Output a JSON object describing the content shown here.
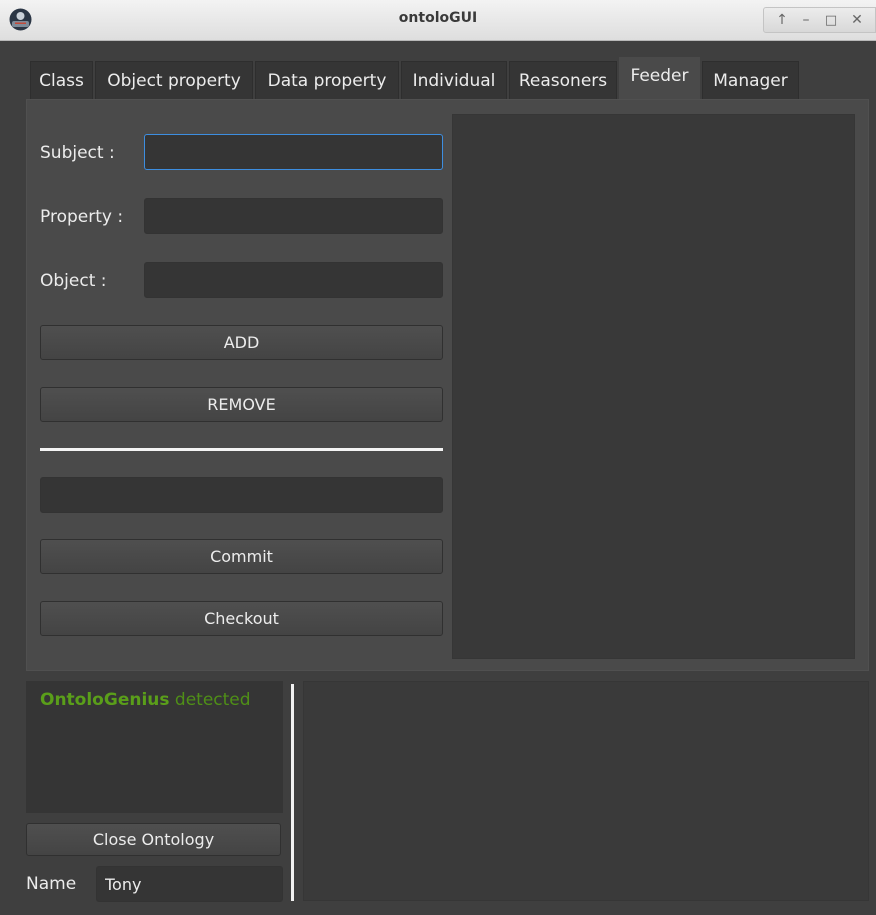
{
  "window": {
    "title": "ontoloGUI"
  },
  "wm": {
    "up": "↑",
    "minimize": "–",
    "maximize": "□",
    "close": "✕"
  },
  "tabs": [
    {
      "label": "Class"
    },
    {
      "label": "Object property"
    },
    {
      "label": "Data property"
    },
    {
      "label": "Individual"
    },
    {
      "label": "Reasoners"
    },
    {
      "label": "Feeder",
      "active": true
    },
    {
      "label": "Manager"
    }
  ],
  "feeder": {
    "subject_label": "Subject :",
    "subject_value": "",
    "property_label": "Property :",
    "property_value": "",
    "object_label": "Object :",
    "object_value": "",
    "add_label": "ADD",
    "remove_label": "REMOVE",
    "commit_field_value": "",
    "commit_label": "Commit",
    "checkout_label": "Checkout"
  },
  "status": {
    "name_part": "OntoloGenius",
    "rest": " detected",
    "color": "#5a9e1a"
  },
  "manager": {
    "close_label": "Close Ontology",
    "name_label": "Name",
    "name_value": "Tony"
  }
}
